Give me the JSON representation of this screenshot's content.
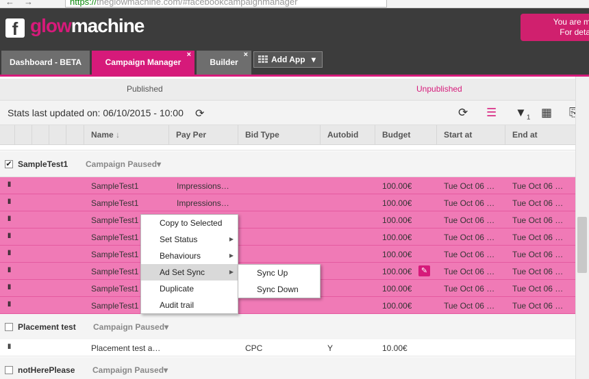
{
  "browser": {
    "url_https": "https://",
    "url_rest": "theglowmachine.com/#facebookcampaignmanager"
  },
  "header": {
    "logo_fb": "f",
    "logo_glow": "glow",
    "logo_machine": "machine",
    "notice_line1": "You are m",
    "notice_line2": "For deta"
  },
  "tabs": [
    {
      "label": "Dashboard - BETA"
    },
    {
      "label": "Campaign Manager",
      "close": "×"
    },
    {
      "label": "Builder",
      "close": "×"
    }
  ],
  "add_app": {
    "label": "Add App",
    "caret": "▾"
  },
  "publish_filter": {
    "published": "Published",
    "unpublished": "Unpublished"
  },
  "stats": {
    "label": "Stats last updated on: 06/10/2015 - 10:00"
  },
  "toolbar_icons": [
    "refresh-icon",
    "list-icon",
    "filter-icon",
    "table-icon",
    "export-icon"
  ],
  "filter_count": "1",
  "columns": [
    "Name",
    "Pay Per",
    "Bid Type",
    "Autobid",
    "Budget",
    "Start at",
    "End at"
  ],
  "sort_indicator": "↓",
  "groups": [
    {
      "name": "SampleTest1",
      "status": "Campaign Paused▾",
      "checked": true,
      "rows": [
        {
          "name": "SampleTest1",
          "pay_per": "Impressions…",
          "bid_type": "",
          "autobid": "",
          "budget": "100.00€",
          "start": "Tue Oct 06 …",
          "end": "Tue Oct 06 …"
        },
        {
          "name": "SampleTest1",
          "pay_per": "Impressions…",
          "bid_type": "",
          "autobid": "",
          "budget": "100.00€",
          "start": "Tue Oct 06 …",
          "end": "Tue Oct 06 …"
        },
        {
          "name": "SampleTest1",
          "pay_per": "",
          "bid_type": "",
          "autobid": "",
          "budget": "100.00€",
          "start": "Tue Oct 06 …",
          "end": "Tue Oct 06 …"
        },
        {
          "name": "SampleTest1",
          "pay_per": "",
          "bid_type": "",
          "autobid": "",
          "budget": "100.00€",
          "start": "Tue Oct 06 …",
          "end": "Tue Oct 06 …"
        },
        {
          "name": "SampleTest1",
          "pay_per": "",
          "bid_type": "",
          "autobid": "",
          "budget": "100.00€",
          "start": "Tue Oct 06 …",
          "end": "Tue Oct 06 …"
        },
        {
          "name": "SampleTest1",
          "pay_per": "",
          "bid_type": "",
          "autobid": "",
          "budget": "100.00€",
          "start": "Tue Oct 06 …",
          "end": "Tue Oct 06 …"
        },
        {
          "name": "SampleTest1",
          "pay_per": "",
          "bid_type": "",
          "autobid": "",
          "budget": "100.00€",
          "start": "Tue Oct 06 …",
          "end": "Tue Oct 06 …"
        },
        {
          "name": "SampleTest1",
          "pay_per": "",
          "bid_type": "",
          "autobid": "",
          "budget": "100.00€",
          "start": "Tue Oct 06 …",
          "end": "Tue Oct 06 …"
        }
      ]
    },
    {
      "name": "Placement test",
      "status": "Campaign Paused▾",
      "checked": false,
      "rows": [
        {
          "name": "Placement test a…",
          "pay_per": "",
          "bid_type": "CPC",
          "autobid": "Y",
          "budget": "10.00€",
          "start": "",
          "end": ""
        }
      ]
    },
    {
      "name": "notHerePlease",
      "status": "Campaign Paused▾",
      "checked": false,
      "rows": []
    }
  ],
  "pause_glyph": "II",
  "checkmark": "✔",
  "context_menu": {
    "items": [
      "Copy to Selected",
      "Set Status",
      "Behaviours",
      "Ad Set Sync",
      "Duplicate",
      "Audit trail"
    ],
    "submenu_arrow": "▶",
    "submenu": [
      "Sync Up",
      "Sync Down"
    ]
  },
  "colors": {
    "brand": "#d61a7a",
    "row_highlight": "#f07ab6",
    "header_bg": "#3c3c3c"
  }
}
